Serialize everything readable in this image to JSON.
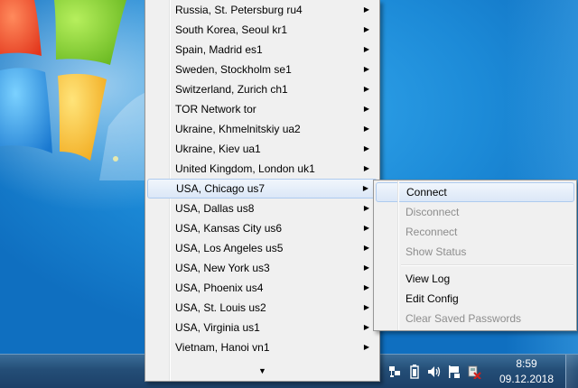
{
  "menu": {
    "items": [
      {
        "label": "Russia, St. Petersburg ru4"
      },
      {
        "label": "South Korea, Seoul kr1"
      },
      {
        "label": "Spain, Madrid es1"
      },
      {
        "label": "Sweden, Stockholm se1"
      },
      {
        "label": "Switzerland, Zurich ch1"
      },
      {
        "label": "TOR Network tor"
      },
      {
        "label": "Ukraine, Khmelnitskiy ua2"
      },
      {
        "label": "Ukraine, Kiev ua1"
      },
      {
        "label": "United Kingdom, London uk1"
      },
      {
        "label": "USA, Chicago us7"
      },
      {
        "label": "USA, Dallas us8"
      },
      {
        "label": "USA, Kansas City us6"
      },
      {
        "label": "USA, Los Angeles us5"
      },
      {
        "label": "USA, New York us3"
      },
      {
        "label": "USA, Phoenix us4"
      },
      {
        "label": "USA, St. Louis us2"
      },
      {
        "label": "USA, Virginia us1"
      },
      {
        "label": "Vietnam, Hanoi vn1"
      }
    ],
    "highlighted": "USA, Chicago us7",
    "submenu_arrow_icon": "triangle-right-icon",
    "scroll_down_icon": "triangle-down-icon"
  },
  "submenu": {
    "connect": "Connect",
    "disconnect": "Disconnect",
    "reconnect": "Reconnect",
    "show_status": "Show Status",
    "view_log": "View Log",
    "edit_config": "Edit Config",
    "clear_passwords": "Clear Saved Passwords"
  },
  "taskbar": {
    "tray_icons": [
      "network-icon",
      "battery-icon",
      "volume-icon",
      "action-center-flag-icon",
      "vpn-disconnected-icon"
    ],
    "clock": {
      "time": "8:59",
      "date": "09.12.2018"
    }
  },
  "colors": {
    "desktop": "#1a8ad6",
    "taskbar": "#244e77",
    "menu_bg": "#f0f0f0",
    "highlight_border": "#aecbef",
    "disabled_text": "#8d8d8d"
  }
}
